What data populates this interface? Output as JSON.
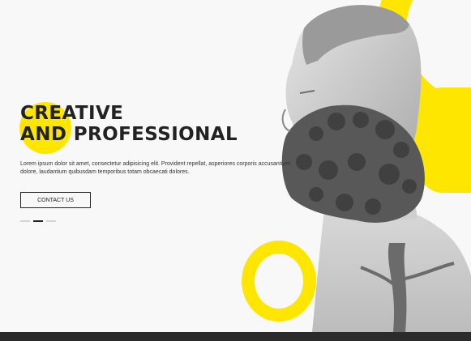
{
  "hero": {
    "headline_line1": "CREATIVE",
    "headline_line2": "AND PROFESSIONAL",
    "lead": "Lorem ipsum dolor sit amet, consectetur adipisicing elit. Provident repellat, asperiores corporis accusantium dolore, laudantium quibusdam temporibus totam obcaecati dolores.",
    "cta_label": "CONTACT US",
    "slides": [
      {
        "active": false
      },
      {
        "active": true
      },
      {
        "active": false
      }
    ]
  },
  "colors": {
    "accent": "#ffe600",
    "text": "#222222",
    "background": "#f8f8f8",
    "footer": "#2b2b2b"
  },
  "icons": {
    "portrait": "bearded-man-double-exposure-portrait"
  }
}
